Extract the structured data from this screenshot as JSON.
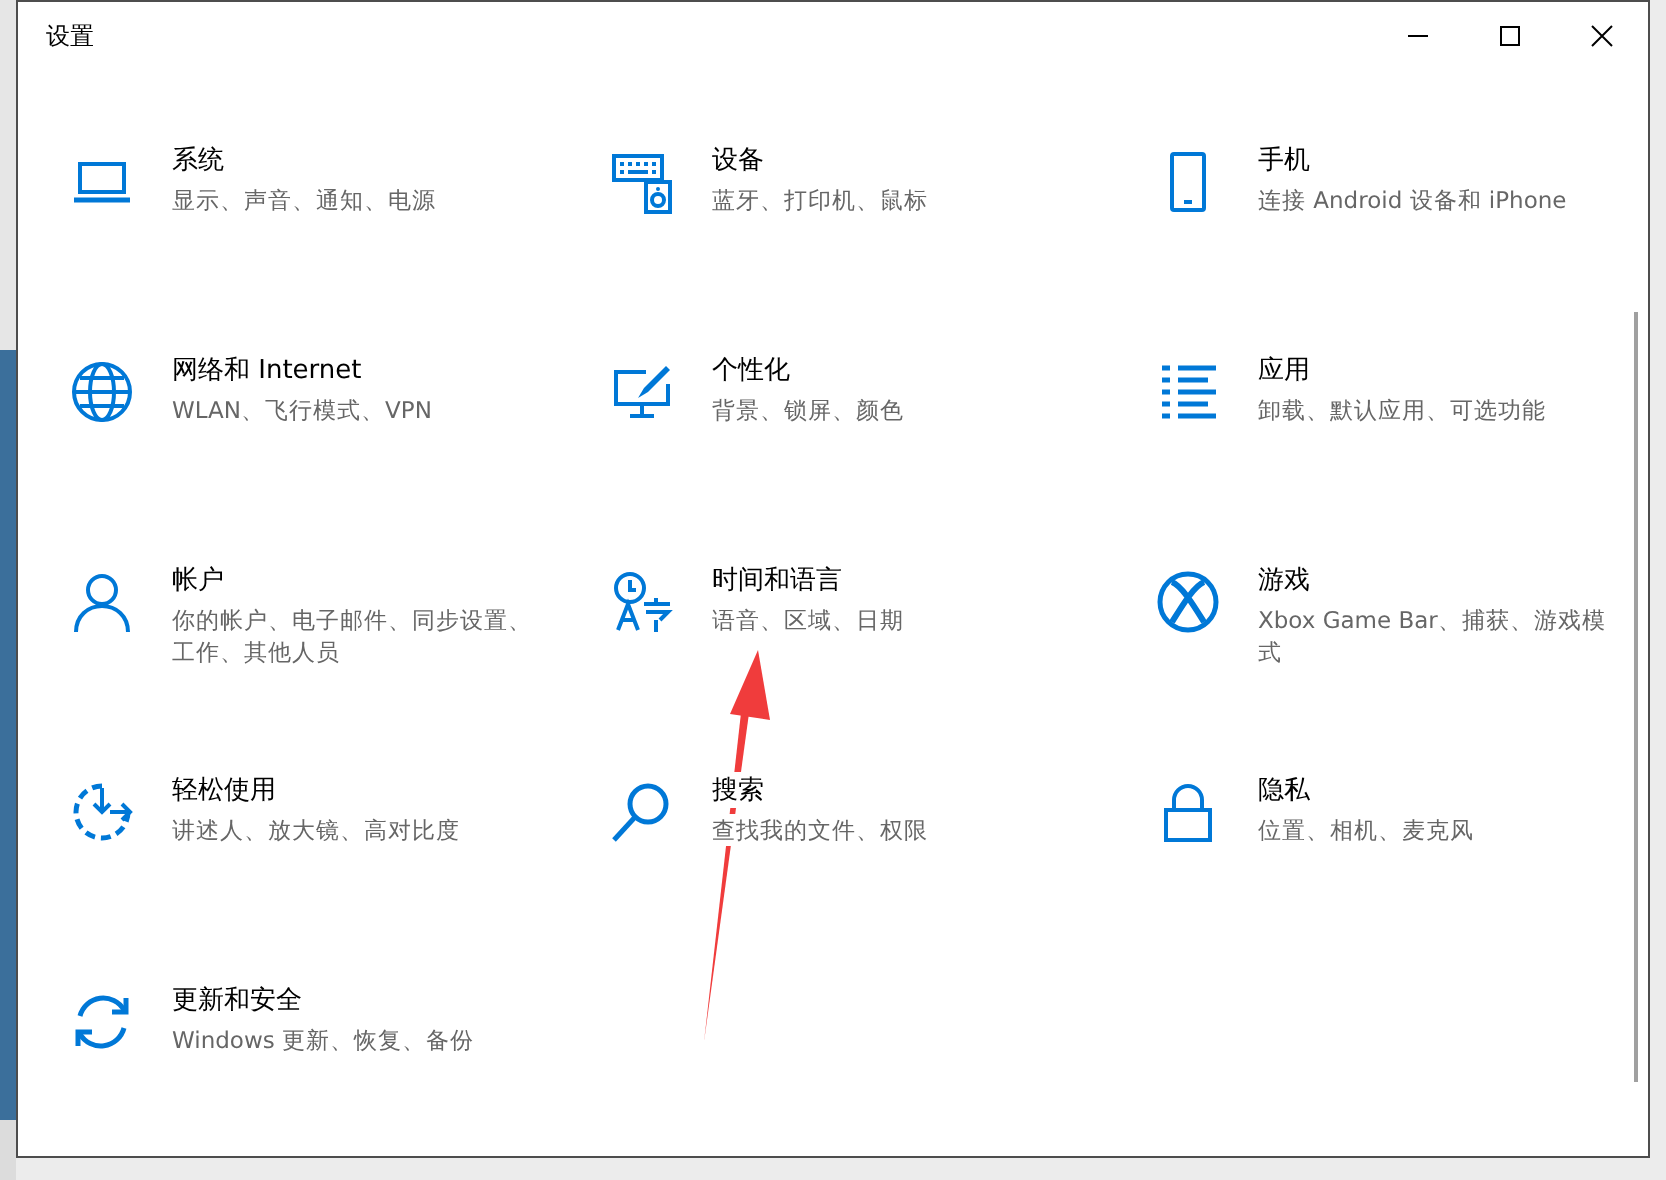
{
  "window": {
    "title": "设置"
  },
  "tiles": [
    {
      "kind": "system",
      "title": "系统",
      "subtitle": "显示、声音、通知、电源"
    },
    {
      "kind": "devices",
      "title": "设备",
      "subtitle": "蓝牙、打印机、鼠标"
    },
    {
      "kind": "phone",
      "title": "手机",
      "subtitle": "连接 Android 设备和 iPhone"
    },
    {
      "kind": "network",
      "title": "网络和 Internet",
      "subtitle": "WLAN、飞行模式、VPN"
    },
    {
      "kind": "personalization",
      "title": "个性化",
      "subtitle": "背景、锁屏、颜色"
    },
    {
      "kind": "apps",
      "title": "应用",
      "subtitle": "卸载、默认应用、可选功能"
    },
    {
      "kind": "accounts",
      "title": "帐户",
      "subtitle": "你的帐户、电子邮件、同步设置、工作、其他人员"
    },
    {
      "kind": "time",
      "title": "时间和语言",
      "subtitle": "语音、区域、日期"
    },
    {
      "kind": "gaming",
      "title": "游戏",
      "subtitle": "Xbox Game Bar、捕获、游戏模式"
    },
    {
      "kind": "ease",
      "title": "轻松使用",
      "subtitle": "讲述人、放大镜、高对比度"
    },
    {
      "kind": "search",
      "title": "搜索",
      "subtitle": "查找我的文件、权限"
    },
    {
      "kind": "privacy",
      "title": "隐私",
      "subtitle": "位置、相机、麦克风"
    },
    {
      "kind": "update",
      "title": "更新和安全",
      "subtitle": "Windows 更新、恢复、备份"
    }
  ]
}
